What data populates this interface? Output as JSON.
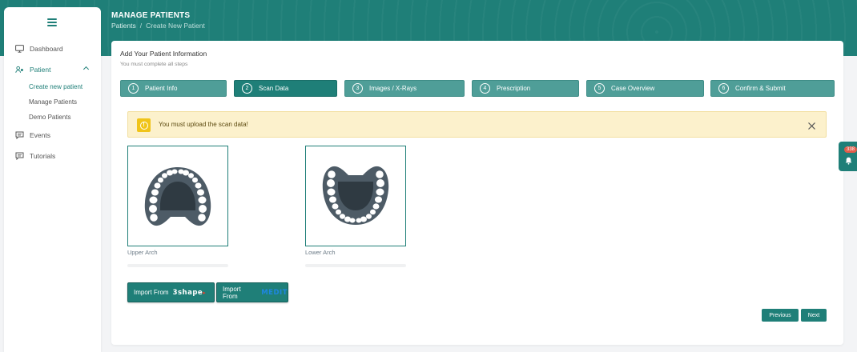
{
  "header": {
    "title": "MANAGE PATIENTS",
    "breadcrumb": [
      "Patients",
      "Create New Patient"
    ],
    "breadcrumb_separator": "/"
  },
  "sidebar": {
    "menu_icon": "hamburger-icon",
    "items": [
      {
        "label": "Dashboard",
        "icon": "monitor-icon"
      },
      {
        "label": "Patient",
        "icon": "patient-icon",
        "expanded": true,
        "children": [
          {
            "label": "Create new patient",
            "active": true
          },
          {
            "label": "Manage Patients"
          },
          {
            "label": "Demo Patients"
          }
        ]
      },
      {
        "label": "Events",
        "icon": "chat-icon"
      },
      {
        "label": "Tutorials",
        "icon": "chat-icon"
      }
    ]
  },
  "form": {
    "title": "Add Your Patient Information",
    "subtitle": "You must complete all steps",
    "steps": [
      {
        "num": "1",
        "label": "Patient Info"
      },
      {
        "num": "2",
        "label": "Scan Data",
        "active": true
      },
      {
        "num": "3",
        "label": "Images / X-Rays"
      },
      {
        "num": "4",
        "label": "Prescription"
      },
      {
        "num": "5",
        "label": "Case Overview"
      },
      {
        "num": "6",
        "label": "Confirm & Submit"
      }
    ],
    "alert": {
      "message": "You must upload the scan data!",
      "icon": "warning-icon"
    },
    "arches": [
      {
        "label": "Upper Arch"
      },
      {
        "label": "Lower Arch"
      }
    ],
    "import_buttons": [
      {
        "prefix": "Import From",
        "brand": "3shape"
      },
      {
        "prefix": "Import From",
        "brand": "MEDIT"
      }
    ],
    "previous_label": "Previous",
    "next_label": "Next"
  },
  "notifications": {
    "count": "338",
    "icon": "bell-icon"
  },
  "colors": {
    "primary": "#1f7f78",
    "step": "#4f9e98",
    "alert_bg": "#fcf1cc",
    "warning": "#f0c419",
    "badge": "#e15c4a"
  }
}
